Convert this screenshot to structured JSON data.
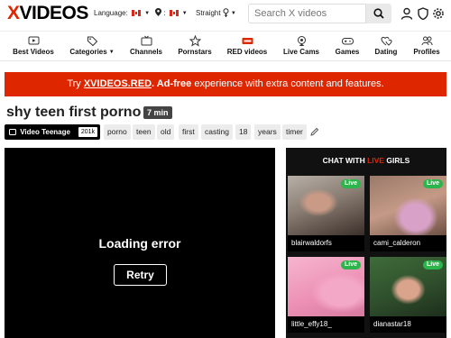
{
  "header": {
    "logo_x": "X",
    "logo_rest": "VIDEOS",
    "language_label": "Language:",
    "orientation_label": "Straight",
    "search_placeholder": "Search X videos"
  },
  "nav": {
    "items": [
      {
        "label": "Best Videos",
        "icon": "play-icon"
      },
      {
        "label": "Categories",
        "icon": "tag-icon"
      },
      {
        "label": "Channels",
        "icon": "tv-icon"
      },
      {
        "label": "Pornstars",
        "icon": "star-icon"
      },
      {
        "label": "RED videos",
        "icon": "red-badge-icon"
      },
      {
        "label": "Live Cams",
        "icon": "webcam-icon"
      },
      {
        "label": "Games",
        "icon": "gamepad-icon"
      },
      {
        "label": "Dating",
        "icon": "hearts-icon"
      },
      {
        "label": "Profiles",
        "icon": "people-icon"
      }
    ]
  },
  "promo": {
    "prefix": "Try ",
    "brand": "XVIDEOS.RED",
    "dot": ". ",
    "adfree": "Ad-free",
    "suffix": " experience with extra content and features."
  },
  "video": {
    "title": "shy teen first porno",
    "duration": "7 min",
    "uploader": "Video Teenage",
    "uploader_count": "201k",
    "tags": [
      "porno",
      "teen",
      "old",
      "first",
      "casting",
      "18",
      "years",
      "timer"
    ]
  },
  "player": {
    "error_text": "Loading error",
    "retry_label": "Retry"
  },
  "chat": {
    "heading_pre": "CHAT WITH ",
    "heading_live": "LIVE",
    "heading_post": " GIRLS",
    "live_badge": "Live",
    "cams": [
      {
        "name": "blairwaldorfs"
      },
      {
        "name": "cami_calderon"
      },
      {
        "name": "little_effy18_"
      },
      {
        "name": "dianastar18"
      }
    ]
  },
  "colors": {
    "brand_red": "#de2600",
    "live_green": "#2bb54a"
  }
}
